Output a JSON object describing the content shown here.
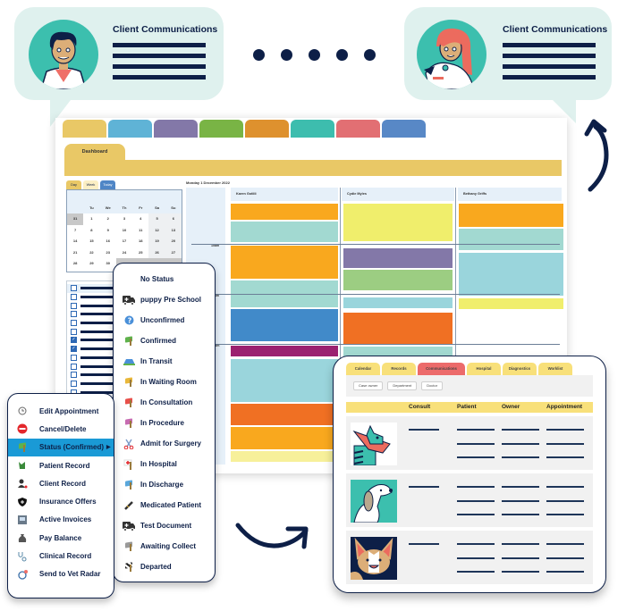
{
  "bubbles": [
    {
      "title": "Client Communications",
      "avatar": "vet-doctor-avatar"
    },
    {
      "title": "Client Communications",
      "avatar": "nurse-with-dog-avatar"
    }
  ],
  "app": {
    "color_tabs": [
      "#e9c866",
      "#5fb3d6",
      "#8378a8",
      "#79b445",
      "#de912e",
      "#3dbdae",
      "#e26f73",
      "#5888c6"
    ],
    "dashboard_tab": "Dashboard",
    "view_tabs": [
      "Day",
      "Week",
      "Today"
    ],
    "date_label": "Monday 1 December 2022",
    "calendar": {
      "day_headers": [
        "",
        "Tu",
        "We",
        "Th",
        "Fr",
        "Sa",
        "Su"
      ],
      "weeks": [
        [
          "31",
          "1",
          "2",
          "3",
          "4",
          "5",
          "6"
        ],
        [
          "7",
          "8",
          "9",
          "10",
          "11",
          "12",
          "13"
        ],
        [
          "14",
          "15",
          "16",
          "17",
          "18",
          "19",
          "20"
        ],
        [
          "21",
          "22",
          "23",
          "24",
          "25",
          "26",
          "27"
        ],
        [
          "28",
          "29",
          "30",
          "",
          "",
          "",
          ""
        ]
      ]
    },
    "task_checks": [
      false,
      false,
      false,
      false,
      false,
      false,
      true,
      true,
      false,
      false,
      false,
      false,
      false,
      false,
      false,
      false
    ],
    "time_labels": [
      "10am",
      "11am",
      "12pm"
    ],
    "schedule_columns": [
      "Karen Gotlili",
      "Cydie Myles",
      "Bethany Griffs"
    ]
  },
  "context_menu": {
    "items": [
      {
        "label": "Edit Appointment",
        "icon": "clock-icon"
      },
      {
        "label": "Cancel/Delete",
        "icon": "no-entry-icon"
      },
      {
        "label": "Status (Confirmed)",
        "icon": "flag-icon",
        "active": true
      },
      {
        "label": "Patient Record",
        "icon": "pet-icon"
      },
      {
        "label": "Client Record",
        "icon": "client-icon"
      },
      {
        "label": "Insurance Offers",
        "icon": "shield-icon"
      },
      {
        "label": "Active Invoices",
        "icon": "invoice-icon"
      },
      {
        "label": "Pay Balance",
        "icon": "money-bag-icon"
      },
      {
        "label": "Clinical Record",
        "icon": "stethoscope-icon"
      },
      {
        "label": "Send to Vet Radar",
        "icon": "vet-radar-icon"
      }
    ]
  },
  "status_menu": {
    "items": [
      {
        "label": "No Status",
        "icon": "none"
      },
      {
        "label": "puppy Pre School",
        "icon": "ambulance-icon"
      },
      {
        "label": "Unconfirmed",
        "icon": "question-icon"
      },
      {
        "label": "Confirmed",
        "icon": "flag-green-icon"
      },
      {
        "label": "In Transit",
        "icon": "car-icon"
      },
      {
        "label": "In Waiting Room",
        "icon": "flag-yellow-icon"
      },
      {
        "label": "In Consultation",
        "icon": "flag-red-icon"
      },
      {
        "label": "In Procedure",
        "icon": "flag-pink-icon"
      },
      {
        "label": "Admit for Surgery",
        "icon": "scissors-icon"
      },
      {
        "label": "In Hospital",
        "icon": "flag-cross-icon"
      },
      {
        "label": "In Discharge",
        "icon": "flag-blue-icon"
      },
      {
        "label": "Medicated Patient",
        "icon": "syringe-icon"
      },
      {
        "label": "Test Document",
        "icon": "ambulance-icon"
      },
      {
        "label": "Awaiting Collect",
        "icon": "flag-grey-icon"
      },
      {
        "label": "Departed",
        "icon": "flag-checkered-icon"
      }
    ]
  },
  "communications": {
    "tabs": [
      {
        "label": "Calendar",
        "color": "#f8e07a"
      },
      {
        "label": "Records",
        "color": "#f8e07a"
      },
      {
        "label": "Communications",
        "color": "#ec6b6b"
      },
      {
        "label": "Hospital",
        "color": "#f8e07a"
      },
      {
        "label": "Diagnostics",
        "color": "#f8e07a"
      },
      {
        "label": "Worklist",
        "color": "#f8e07a"
      }
    ],
    "filters": [
      "Case owner",
      "Department",
      "Doctor"
    ],
    "columns": [
      "Consult",
      "Patient",
      "Owner",
      "Appointment"
    ],
    "rows": [
      {
        "pet": "cat-with-cone"
      },
      {
        "pet": "beagle-dog"
      },
      {
        "pet": "corgi-dog"
      }
    ]
  }
}
